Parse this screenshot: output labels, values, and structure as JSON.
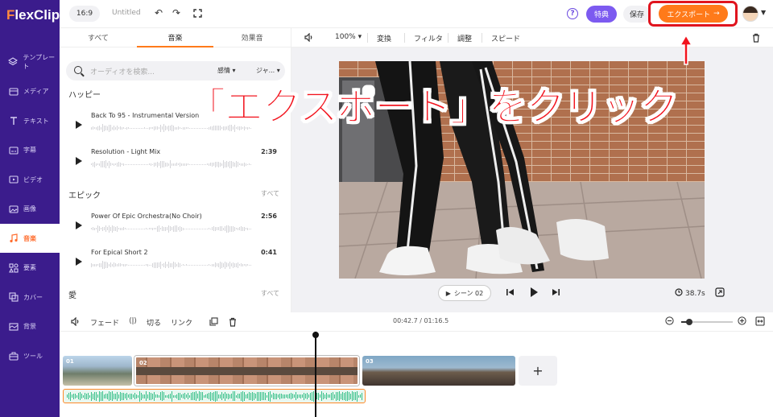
{
  "app": {
    "logo_accent": "F",
    "logo_rest": "lexClip"
  },
  "sidebar": {
    "items": [
      {
        "label": "テンプレート",
        "icon": "layers-icon"
      },
      {
        "label": "メディア",
        "icon": "media-icon"
      },
      {
        "label": "テキスト",
        "icon": "text-icon"
      },
      {
        "label": "字幕",
        "icon": "subtitle-icon"
      },
      {
        "label": "ビデオ",
        "icon": "video-icon"
      },
      {
        "label": "画像",
        "icon": "image-icon"
      },
      {
        "label": "音楽",
        "icon": "music-icon",
        "active": true
      },
      {
        "label": "要素",
        "icon": "elements-icon"
      },
      {
        "label": "カバー",
        "icon": "cover-icon"
      },
      {
        "label": "背景",
        "icon": "background-icon"
      },
      {
        "label": "ツール",
        "icon": "tools-icon"
      }
    ]
  },
  "topbar": {
    "ratio": "16:9",
    "title": "Untitled",
    "help": "?",
    "perk": "特典",
    "save": "保存",
    "export": "エクスポート",
    "export_arrow": "→"
  },
  "panel": {
    "tabs": [
      "すべて",
      "音楽",
      "効果音"
    ],
    "active_tab": 1,
    "search_placeholder": "オーディオを検索...",
    "filter1": "感情",
    "filter2": "ジャ...",
    "sections": [
      {
        "title": "ハッピー",
        "see_all": "",
        "tracks": [
          {
            "name": "Back To 95 - Instrumental Version",
            "duration": ""
          },
          {
            "name": "Resolution - Light Mix",
            "duration": "2:39"
          }
        ]
      },
      {
        "title": "エピック",
        "see_all": "すべて",
        "tracks": [
          {
            "name": "Power Of Epic Orchestra(No Choir)",
            "duration": "2:56"
          },
          {
            "name": "For Epical Short 2",
            "duration": "0:41"
          }
        ]
      },
      {
        "title": "愛",
        "see_all": "すべて",
        "tracks": []
      }
    ]
  },
  "preview_toolbar": {
    "zoom": "100%",
    "items": [
      "変換",
      "フィルタ",
      "調整",
      "スピード"
    ]
  },
  "player": {
    "scene": "シーン 02",
    "duration": "38.7s"
  },
  "callout": "「エクスポート」をクリック",
  "timeline": {
    "tools": [
      "フェード",
      "切る",
      "リンク"
    ],
    "time": "00:42.7 / 01:16.5",
    "zoom_level": 0.15,
    "clips": [
      "01",
      "02",
      "03"
    ],
    "add": "+"
  },
  "colors": {
    "sidebar": "#3b1c8c",
    "accent": "#ff7a1a",
    "purple": "#7c5af0",
    "annotation": "#f2141e",
    "audio_wave": "#35c089"
  }
}
